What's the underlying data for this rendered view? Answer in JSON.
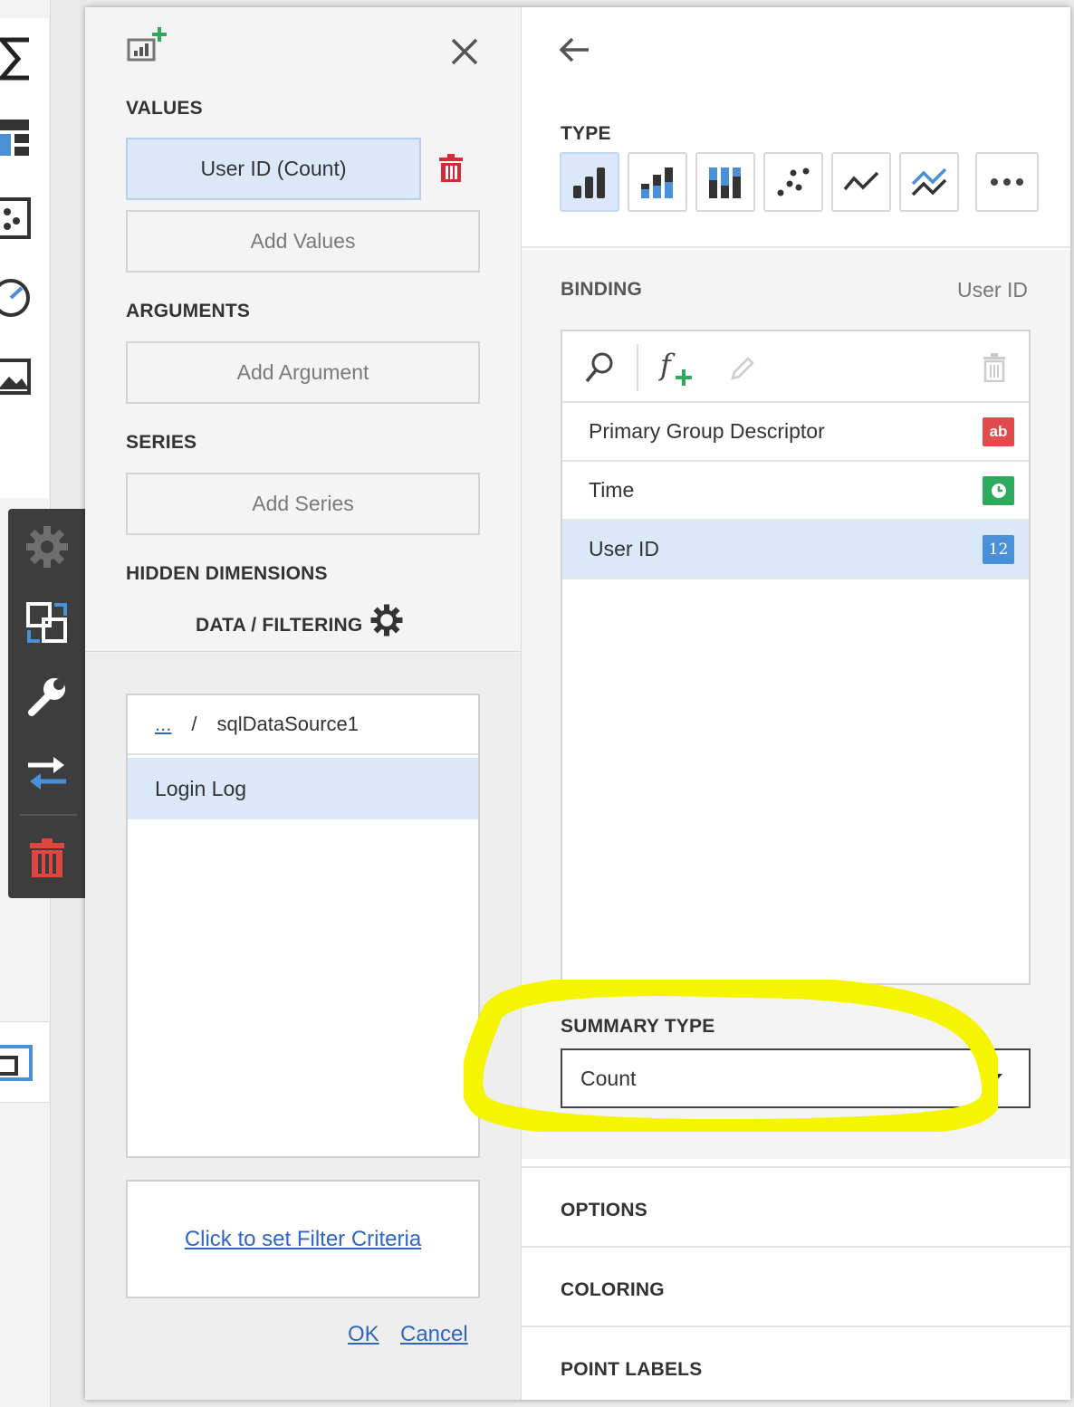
{
  "panel": {
    "values_label": "VALUES",
    "value_item": "User ID (Count)",
    "add_values": "Add Values",
    "arguments_label": "ARGUMENTS",
    "add_argument": "Add Argument",
    "series_label": "SERIES",
    "add_series": "Add Series",
    "hidden_dimensions_label": "HIDDEN DIMENSIONS",
    "data_filtering_label": "DATA / FILTERING"
  },
  "datasource": {
    "path_dots": "...",
    "path_sep": "/",
    "path_name": "sqlDataSource1",
    "items": [
      "Login Log"
    ]
  },
  "filter": {
    "link": "Click to set Filter Criteria",
    "ok": "OK",
    "cancel": "Cancel"
  },
  "type_section": {
    "label": "TYPE",
    "types": [
      "bar-chart-icon",
      "stacked-bar-icon",
      "full-stacked-bar-icon",
      "point-chart-icon",
      "line-chart-icon",
      "stacked-line-icon",
      "more-icon"
    ]
  },
  "binding": {
    "label": "BINDING",
    "current": "User ID",
    "fields": [
      {
        "name": "Primary Group Descriptor",
        "badge": "ab",
        "badge_color": "#e04b4b"
      },
      {
        "name": "Time",
        "badge": "",
        "badge_color": "#2eaa5c"
      },
      {
        "name": "User ID",
        "badge": "12",
        "badge_color": "#4a90d9"
      }
    ]
  },
  "summary": {
    "label": "SUMMARY TYPE",
    "value": "Count"
  },
  "sections": {
    "options": "OPTIONS",
    "coloring": "COLORING",
    "point_labels": "POINT LABELS"
  },
  "colors": {
    "accent_blue": "#4a90d9",
    "selected_bg": "#dbe8fa",
    "delete_red": "#d9283a",
    "highlight_yellow": "#f5f500",
    "toolbar_dark": "#3d3d3d"
  }
}
